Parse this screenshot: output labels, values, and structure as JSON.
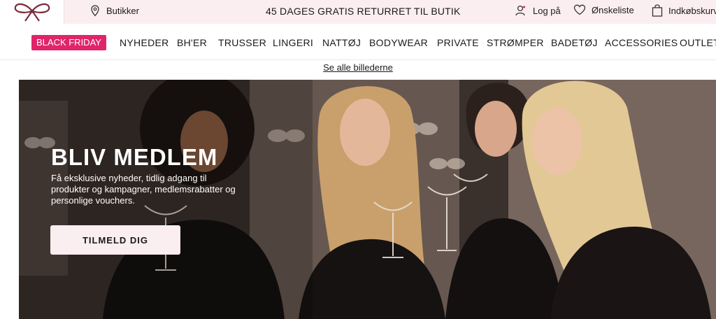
{
  "topbar": {
    "stores_label": "Butikker",
    "promo_text": "45 DAGES GRATIS RETURRET TIL BUTIK",
    "login_label": "Log på",
    "wishlist_label": "Ønskeliste",
    "cart_label": "Indkøbskurv"
  },
  "nav": {
    "black_friday": "BLACK FRIDAY",
    "items": [
      "NYHEDER",
      "BH'ER",
      "TRUSSER",
      "LINGERI",
      "NATTØJ",
      "BODYWEAR",
      "PRIVATE",
      "STRØMPER",
      "BADETØJ",
      "ACCESSORIES",
      "OUTLET"
    ]
  },
  "see_all": "Se alle billederne",
  "hero": {
    "title": "BLIV MEDLEM",
    "text": "Få eksklusive nyheder, tidlig adgang til produkter og kampagner, medlemsrabatter og personlige vouchers.",
    "button_label": "TILMELD DIG"
  },
  "colors": {
    "accent_pink": "#e0246a",
    "topbar_bg": "#fbeef0",
    "brand_burgundy": "#7a2c3c"
  },
  "icons": [
    "bow-logo-icon",
    "location-pin-icon",
    "user-icon",
    "heart-icon",
    "shopping-bag-icon"
  ]
}
